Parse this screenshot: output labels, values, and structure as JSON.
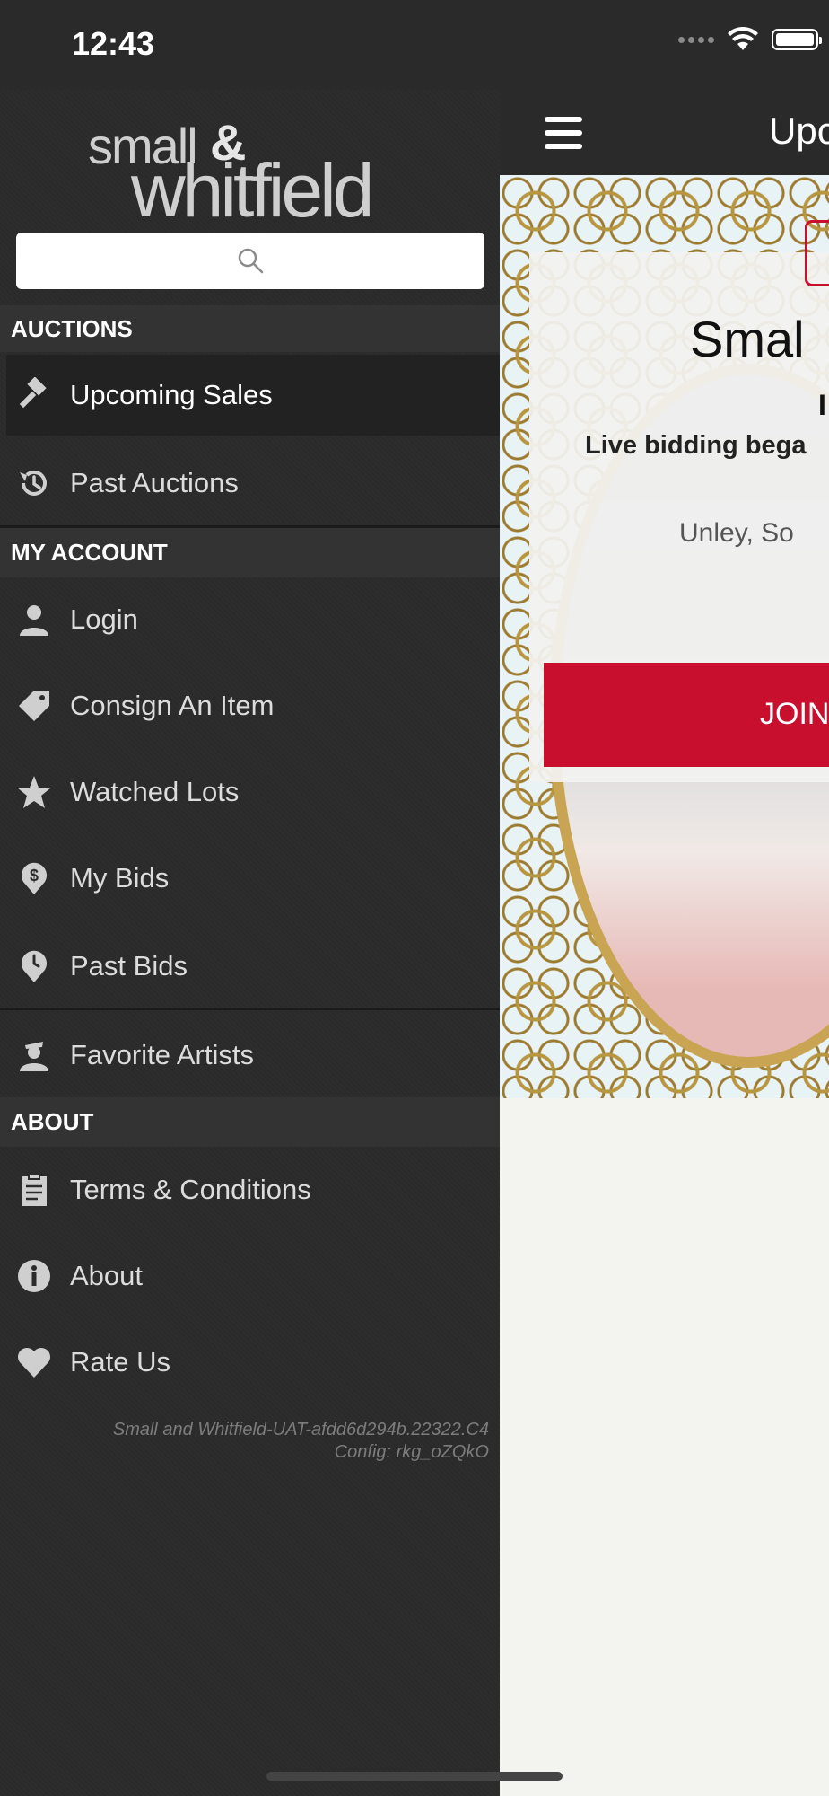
{
  "status_bar": {
    "time": "12:43"
  },
  "drawer": {
    "logo_line1": "small",
    "logo_amp": "&",
    "logo_line2": "whitfield",
    "search_placeholder": "",
    "sections": {
      "auctions": "AUCTIONS",
      "my_account": "MY ACCOUNT",
      "about": "ABOUT"
    },
    "items": {
      "upcoming_sales": "Upcoming Sales",
      "past_auctions": "Past Auctions",
      "login": "Login",
      "consign": "Consign An Item",
      "watched_lots": "Watched Lots",
      "my_bids": "My Bids",
      "past_bids": "Past Bids",
      "favorite_artists": "Favorite Artists",
      "terms": "Terms & Conditions",
      "about": "About",
      "rate_us": "Rate Us"
    },
    "version_line1": "Small and Whitfield-UAT-afdd6d294b.22322.C4",
    "version_line2": "Config: rkg_oZQkO"
  },
  "topbar": {
    "title": "Upc"
  },
  "hero": {
    "title": "Smal",
    "sub1": "I",
    "sub2": "Live bidding bega",
    "location": "Unley, So",
    "join_label": "JOIN"
  },
  "colors": {
    "accent": "#c8102e",
    "drawer_bg": "#2b2b2b"
  },
  "icons": [
    "search-icon",
    "gavel-icon",
    "history-icon",
    "user-icon",
    "tag-icon",
    "star-icon",
    "dollar-pin-icon",
    "clock-pin-icon",
    "artist-icon",
    "clipboard-icon",
    "info-icon",
    "heart-icon",
    "hamburger-icon"
  ]
}
